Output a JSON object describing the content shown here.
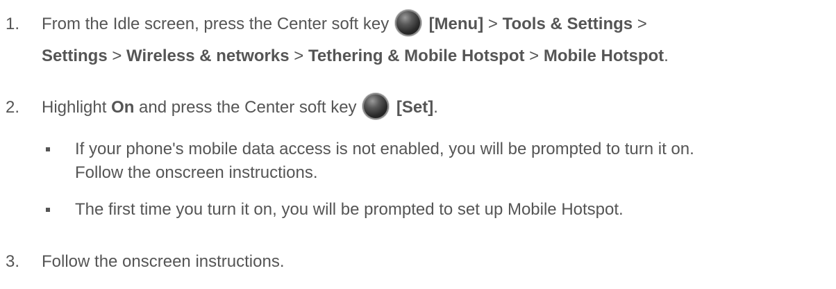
{
  "steps": [
    {
      "number": "1.",
      "line1": {
        "t1": "From the Idle screen, press the Center soft key",
        "t2": "[Menu]",
        "t3": " > ",
        "t4": "Tools & Settings",
        "t5": " >"
      },
      "line2": {
        "t1": "Settings",
        "t2": " > ",
        "t3": "Wireless & networks",
        "t4": " > ",
        "t5": "Tethering & Mobile Hotspot",
        "t6": " > ",
        "t7": "Mobile Hotspot",
        "t8": "."
      }
    },
    {
      "number": "2.",
      "t1": "Highlight ",
      "t2": "On",
      "t3": " and press the Center soft key",
      "t4": "[Set]",
      "t5": "."
    },
    {
      "number": "3.",
      "text": "Follow the onscreen instructions."
    }
  ],
  "bullets": [
    {
      "line1": "If your phone's mobile data access is not enabled, you will be prompted to turn it on.",
      "line2": "Follow the onscreen instructions."
    },
    {
      "line1": "The first time you turn it on, you will be prompted to set up Mobile Hotspot."
    }
  ],
  "icons": {
    "center_key": "center-soft-key-icon"
  },
  "colors": {
    "text": "#555555"
  }
}
